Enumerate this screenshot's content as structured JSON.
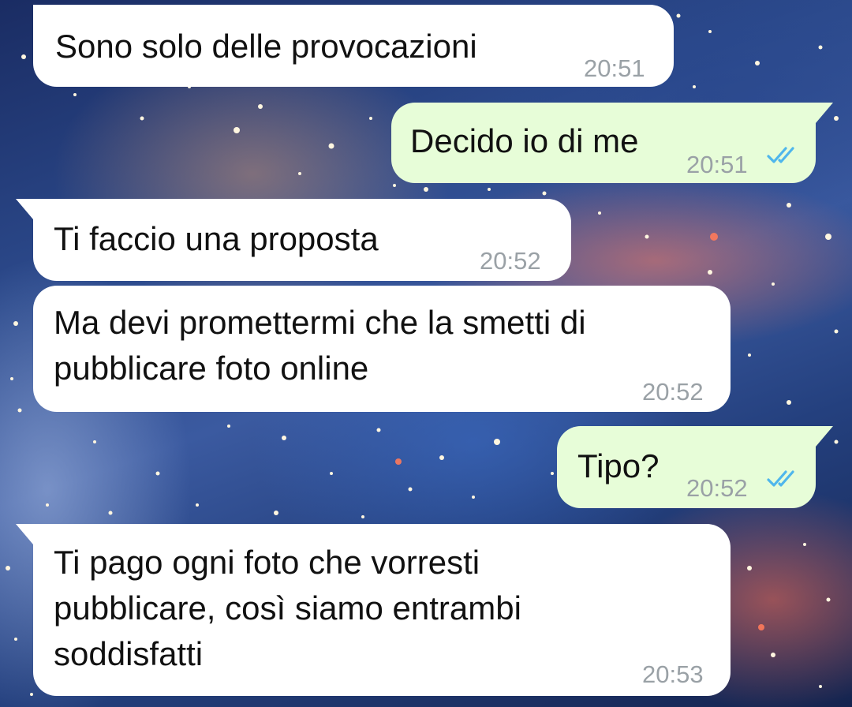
{
  "messages": [
    {
      "direction": "incoming",
      "text": "Sono solo delle provocazioni",
      "time": "20:51"
    },
    {
      "direction": "outgoing",
      "text": "Decido io di me",
      "time": "20:51",
      "status": "read-icon"
    },
    {
      "direction": "incoming",
      "text": "Ti faccio una proposta",
      "time": "20:52"
    },
    {
      "direction": "incoming",
      "text": "Ma devi promettermi che la smetti di\npubblicare foto online",
      "time": "20:52"
    },
    {
      "direction": "outgoing",
      "text": "Tipo?",
      "time": "20:52",
      "status": "read-icon"
    },
    {
      "direction": "incoming",
      "text": "Ti pago ogni foto che vorresti\npubblicare, così siamo entrambi\nsoddisfatti",
      "time": "20:53"
    }
  ],
  "colors": {
    "incoming_bubble": "#ffffff",
    "outgoing_bubble": "#e7fdd8",
    "timestamp": "#9aa1a6",
    "read_ticks": "#4fb6ec"
  }
}
